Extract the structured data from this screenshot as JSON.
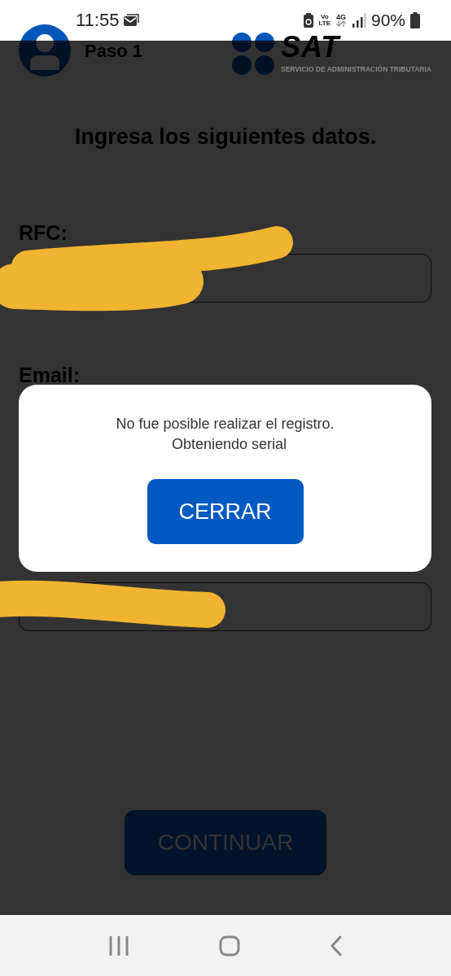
{
  "status_bar": {
    "time": "11:55",
    "volte": [
      "Vo",
      "LTE"
    ],
    "network": "4G",
    "battery": "90%"
  },
  "header": {
    "step": "Paso 1",
    "logo": {
      "name": "SAT",
      "subtitle": "SERVICIO DE ADMINISTRACIÓN TRIBUTARIA"
    }
  },
  "title": "Ingresa los siguientes datos.",
  "fields": [
    {
      "label": "RFC:",
      "redacted": true
    },
    {
      "label": "Email:",
      "redacted": false
    },
    {
      "redacted": true
    }
  ],
  "continue_button": "CONTINUAR",
  "dialog": {
    "message": "No fue posible realizar el registro.\n  Obteniendo serial",
    "button": "CERRAR"
  }
}
